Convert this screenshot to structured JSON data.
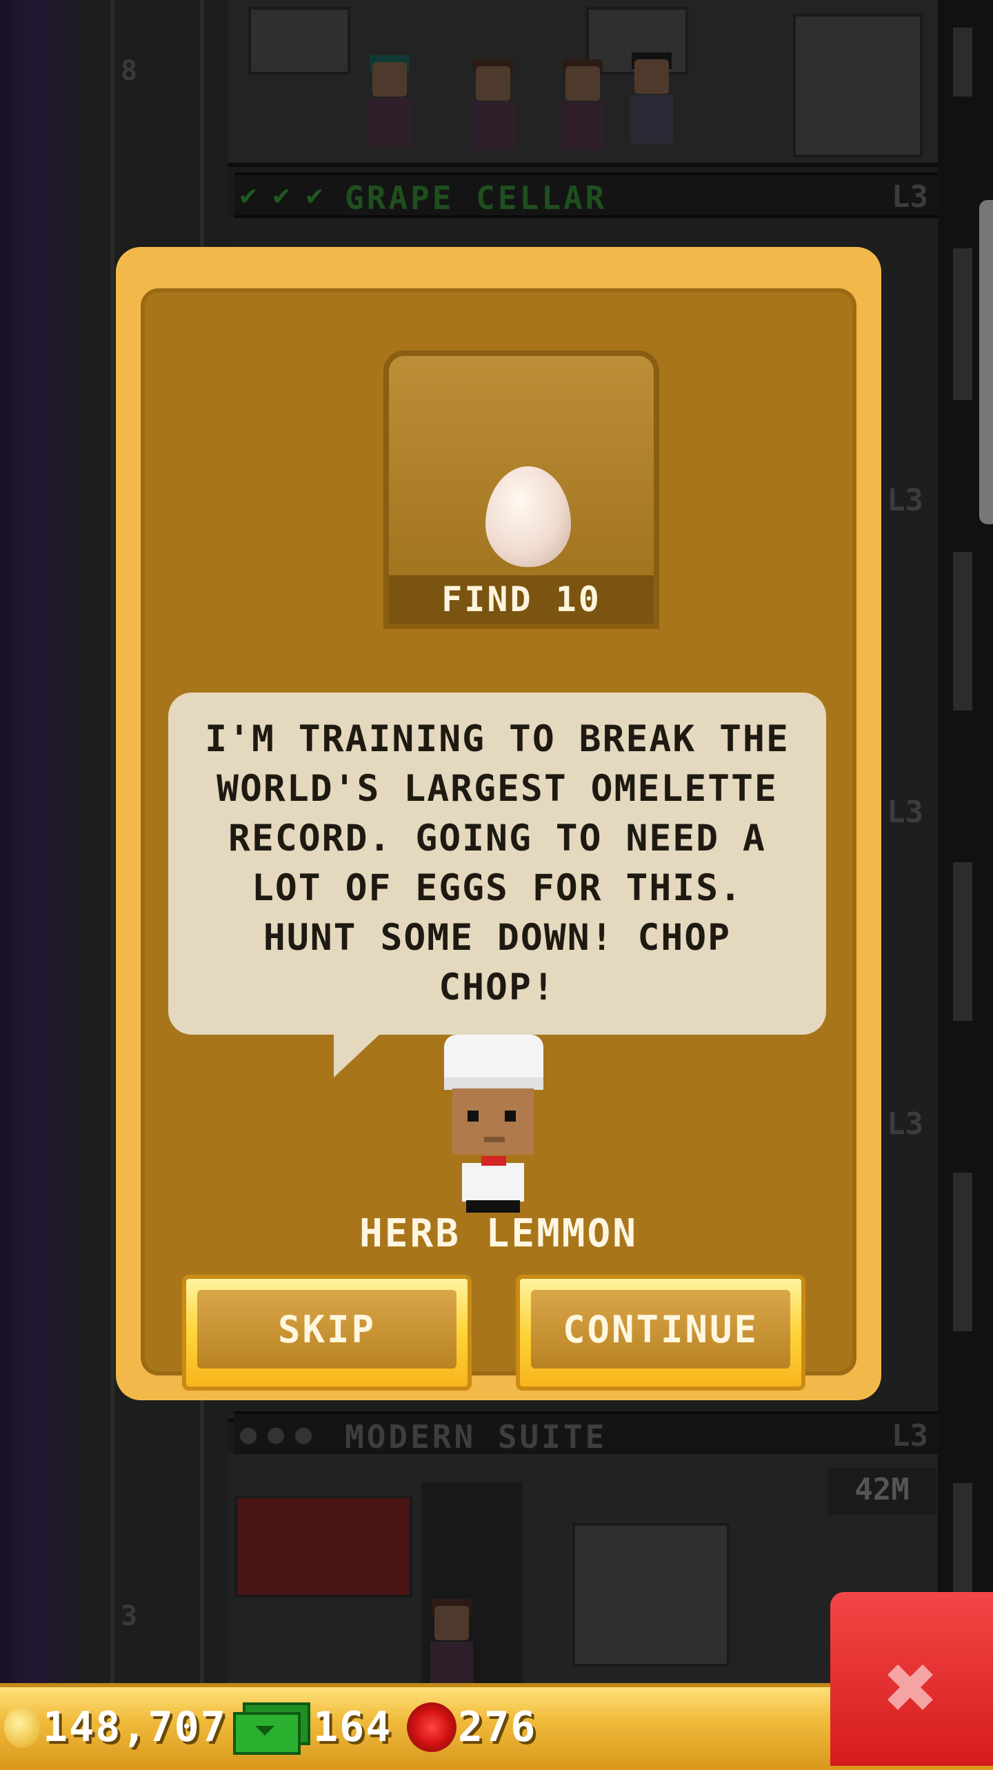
{
  "background": {
    "floors": [
      {
        "title": "GRAPE CELLAR",
        "level": "L3",
        "status": "complete",
        "title_color": "#1f4f1f"
      },
      {
        "title": "MODERN SUITE",
        "level": "L3",
        "status": "empty",
        "title_color": "#3e3e3e"
      }
    ],
    "side_levels": [
      "L3",
      "L3",
      "L3",
      "L3"
    ],
    "floor_numbers": [
      "8",
      "3"
    ],
    "room_price": "42M"
  },
  "dialog": {
    "reward": {
      "icon": "egg-icon",
      "label": "FIND 10"
    },
    "speech": "I'M TRAINING TO BREAK THE WORLD'S LARGEST OMELETTE RECORD. GOING TO NEED A LOT OF EGGS FOR THIS. HUNT SOME DOWN! CHOP CHOP!",
    "npc_name": "HERB LEMMON",
    "buttons": {
      "skip": "SKIP",
      "continue": "CONTINUE"
    }
  },
  "currency": {
    "coins": "148,707",
    "bux": "164",
    "tokens": "276"
  },
  "colors": {
    "dialog_outer": "#f2b94a",
    "dialog_inner": "#a8751a",
    "speech_bubble": "#e4d8be",
    "close_button": "#d61c1c"
  }
}
